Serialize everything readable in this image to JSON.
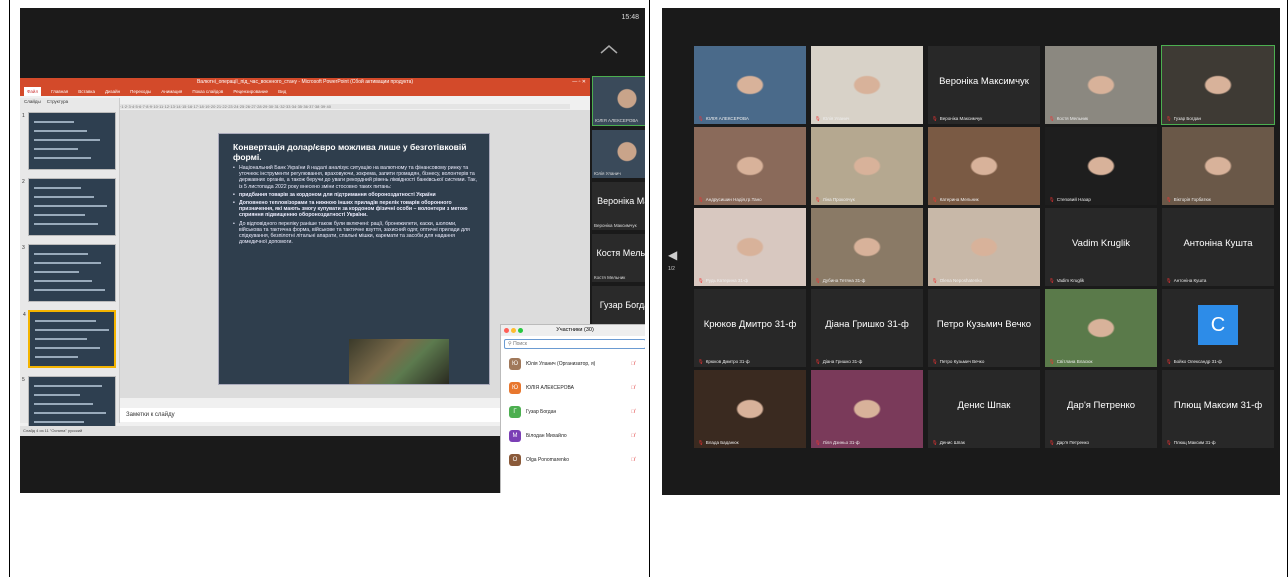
{
  "left": {
    "clock": "15:48",
    "powerpoint": {
      "title": "Валютні_операції_під_час_воєнного_стану - Microsoft PowerPoint (Сбой активации продукта)",
      "menu": [
        "Файл",
        "Главная",
        "Вставка",
        "Дизайн",
        "Переходы",
        "Анимация",
        "Показ слайдов",
        "Рецензирование",
        "Вид"
      ],
      "tabs": [
        "Слайды",
        "Структура"
      ],
      "slide_numbers": [
        "1",
        "2",
        "3",
        "4",
        "5"
      ],
      "slide": {
        "heading": "Конвертація долар/євро можлива лише у безготівковій формі.",
        "bullets": [
          "Національний Банк України й надалі аналізує ситуацію на валютному та фінансовому ринку та уточнює інструменти регулювання, враховуючи, зокрема, запити громадян, бізнесу, волонтерів та державних органів, а також беручи до уваги рекордний рівень ліквідності банківської системи. Так, із 5 листопада 2022 року внесено зміни стосовно таких питань:",
          "придбання товарів за кордоном для підтримання обороноздатності України",
          "Доповнено тепловізорами та нижною інших приладів перелік товарів оборонного призначення, які мають змогу купувати за кордоном фізичні особи – волонтери з метою сприяння підвищенню обороноздатності України.",
          "До відповідного переліку раніше також були включені: рації, бронежилети, каски, шоломи, військова та тактична форма, військове та тактичне взуття, захисний одяг, оптичні прилади для спідкування, безпілотні літальні апарати, спальні мішки, каремати та засоби для надання домедичної допомоги."
        ]
      },
      "notes": "Заметки к слайду",
      "status": "Слайд 4 из 11   \"Оснина\"   русский"
    },
    "participants": {
      "title": "Участники (30)",
      "search_placeholder": "Поиск",
      "rows": [
        {
          "initial": "Ю",
          "name": "Юлія Уланич (Организатор, я)",
          "color": "#a0785a"
        },
        {
          "initial": "Ю",
          "name": "ЮЛІЯ АЛЕКСЕРОВА",
          "color": "#e8772e"
        },
        {
          "initial": "Г",
          "name": "Гузар Богдан",
          "color": "#4caf50"
        },
        {
          "initial": "М",
          "name": "Білодан Михайло",
          "color": "#7b3fb5"
        },
        {
          "initial": "О",
          "name": "Olga Ponomarenko",
          "color": "#8a5a3a"
        }
      ]
    },
    "strip": [
      {
        "big": "",
        "small": "ЮЛІЯ АЛЕКСЕРОВА",
        "video": true
      },
      {
        "big": "",
        "small": "Юлія Уланич",
        "video": true
      },
      {
        "big": "Вероніка Ма...",
        "small": "Вероніка Максимчук",
        "video": false
      },
      {
        "big": "Костя Мельн...",
        "small": "Костя Мельник",
        "video": false
      },
      {
        "big": "Гузар Богдан",
        "small": "Гузар Богдан",
        "video": false
      }
    ]
  },
  "right": {
    "page": "1/2",
    "tiles": [
      {
        "big": "",
        "label": "ЮЛІЯ АЛЕКСЕРОВА",
        "video": "#4a6a8a"
      },
      {
        "big": "",
        "label": "Юлія Уланич",
        "video": "#d8d2c8"
      },
      {
        "big": "Вероніка Максимчук",
        "label": "Вероніка Максимчук",
        "video": ""
      },
      {
        "big": "",
        "label": "Костя Мельник",
        "video": "#8b8880"
      },
      {
        "big": "",
        "label": "Гузар Богдан",
        "video": "#3e3a34"
      },
      {
        "big": "",
        "label": "Андрусишин Надія,гр.Тано",
        "video": "#8a6a5a"
      },
      {
        "big": "",
        "label": "Ліна Прокопчук",
        "video": "#b5a890"
      },
      {
        "big": "",
        "label": "Катерина Мельник",
        "video": "#7a5a44"
      },
      {
        "big": "",
        "label": "Степовий Назар",
        "video": "#1e1e1e"
      },
      {
        "big": "",
        "label": "Вікторія Горбатюк",
        "video": "#6a5848"
      },
      {
        "big": "",
        "label": "Рудь Катерина 31-ф",
        "video": "#d8c8c0"
      },
      {
        "big": "",
        "label": "Дубина Тетяна 31-ф",
        "video": "#8a7a66"
      },
      {
        "big": "",
        "label": "Olena Neposhatenko",
        "video": "#c8b8a8"
      },
      {
        "big": "Vadim Kruglik",
        "label": "Vadim Kruglik",
        "video": ""
      },
      {
        "big": "Антоніна Кушта",
        "label": "Антоніна Кушта",
        "video": ""
      },
      {
        "big": "Крюков Дмитро 31-ф",
        "label": "Крюков Дмитро 31-ф",
        "video": ""
      },
      {
        "big": "Діана Гришко 31-ф",
        "label": "Діана Гришко 31-ф",
        "video": ""
      },
      {
        "big": "Петро Кузьмич Вечко",
        "label": "Петро Кузьмич Вечко",
        "video": ""
      },
      {
        "big": "",
        "label": "Світлана Власюк",
        "video": "#5a7a4a"
      },
      {
        "big": "C",
        "label": "Бойко Олександр 31-ф",
        "video": "avatar"
      },
      {
        "big": "",
        "label": "Влада Баданюк",
        "video": "#3a2a20"
      },
      {
        "big": "",
        "label": "Ліля Дзиньо 31-ф",
        "video": "#7a3a5a"
      },
      {
        "big": "Денис Шпак",
        "label": "Денис Шпак",
        "video": ""
      },
      {
        "big": "Дар'я Петренко",
        "label": "Дар'я Петренко",
        "video": ""
      },
      {
        "big": "Плющ Максим 31-ф",
        "label": "Плющ Максим 31-ф",
        "video": ""
      }
    ]
  }
}
